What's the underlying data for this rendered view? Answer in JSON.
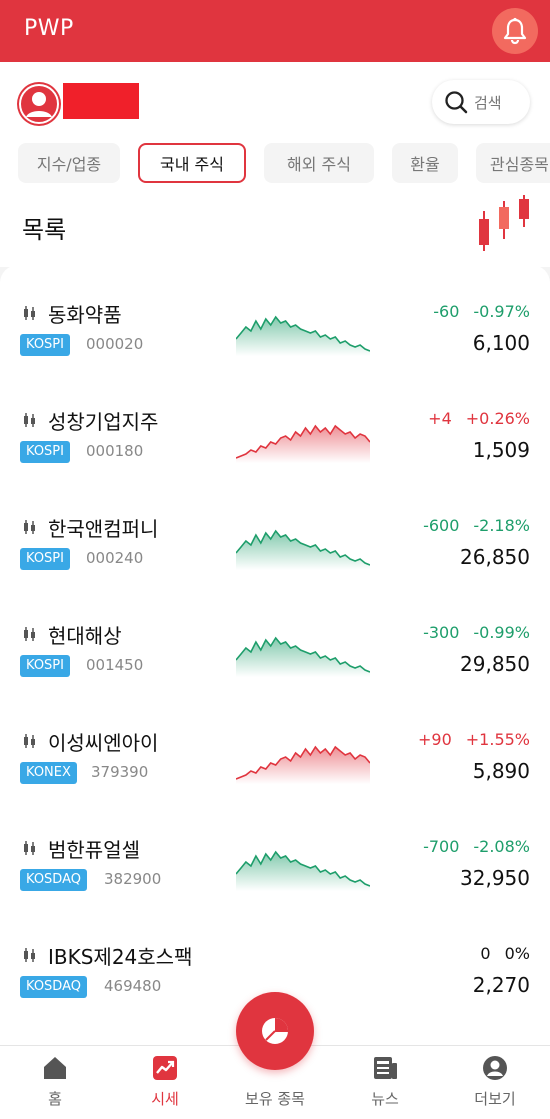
{
  "app": {
    "title": "PWP"
  },
  "header": {
    "search_label": "검색"
  },
  "tabs": [
    {
      "label": "지수/업종",
      "active": false
    },
    {
      "label": "국내 주식",
      "active": true
    },
    {
      "label": "해외 주식",
      "active": false
    },
    {
      "label": "환율",
      "active": false
    },
    {
      "label": "관심종목",
      "active": false
    }
  ],
  "list": {
    "title": "목록",
    "items": [
      {
        "name": "동화약품",
        "market": "KOSPI",
        "code": "000020",
        "change": "-60",
        "change_pct": "-0.97%",
        "price": "6,100",
        "trend": "down"
      },
      {
        "name": "성창기업지주",
        "market": "KOSPI",
        "code": "000180",
        "change": "+4",
        "change_pct": "+0.26%",
        "price": "1,509",
        "trend": "up"
      },
      {
        "name": "한국앤컴퍼니",
        "market": "KOSPI",
        "code": "000240",
        "change": "-600",
        "change_pct": "-2.18%",
        "price": "26,850",
        "trend": "down"
      },
      {
        "name": "현대해상",
        "market": "KOSPI",
        "code": "001450",
        "change": "-300",
        "change_pct": "-0.99%",
        "price": "29,850",
        "trend": "down"
      },
      {
        "name": "이성씨엔아이",
        "market": "KONEX",
        "code": "379390",
        "change": "+90",
        "change_pct": "+1.55%",
        "price": "5,890",
        "trend": "up"
      },
      {
        "name": "범한퓨얼셀",
        "market": "KOSDAQ",
        "code": "382900",
        "change": "-700",
        "change_pct": "-2.08%",
        "price": "32,950",
        "trend": "down"
      },
      {
        "name": "IBKS제24호스팩",
        "market": "KOSDAQ",
        "code": "469480",
        "change": "0",
        "change_pct": "0%",
        "price": "2,270",
        "trend": "flat"
      }
    ]
  },
  "nav": {
    "home": "홈",
    "market": "시세",
    "holdings": "보유 종목",
    "news": "뉴스",
    "more": "더보기"
  },
  "colors": {
    "brand": "#e0353f",
    "down": "#1e9e6b",
    "up": "#e0353f",
    "market_badge": "#39a8e6"
  }
}
